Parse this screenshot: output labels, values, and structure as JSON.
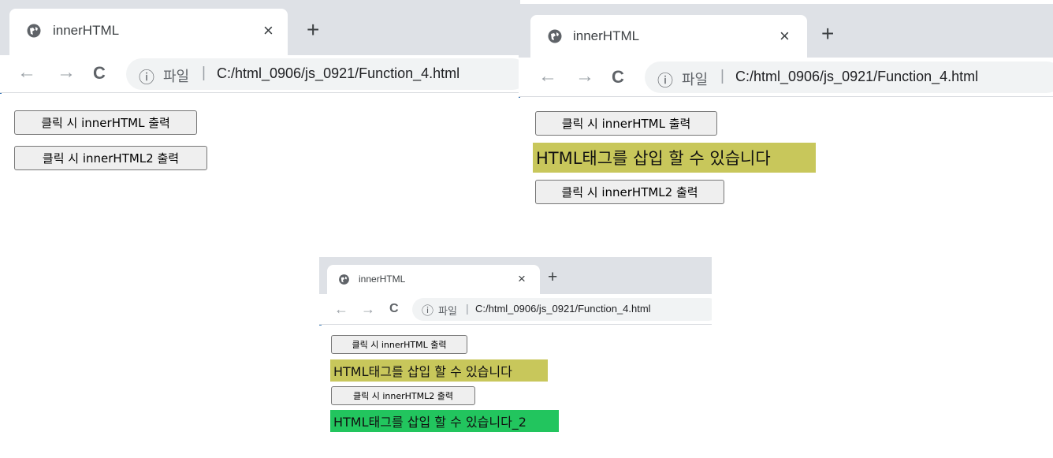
{
  "windows": [
    {
      "tab_title": "innerHTML",
      "tab_close": "×",
      "new_tab": "+",
      "nav": {
        "back": "←",
        "forward": "→",
        "reload": "C"
      },
      "address": {
        "info": "ⓘ",
        "scheme": "파일",
        "separator": "|",
        "url": "C:/html_0906/js_0921/Function_4.html"
      },
      "button1": "클릭 시 innerHTML 출력",
      "button2": "클릭 시 innerHTML2 출력"
    },
    {
      "tab_title": "innerHTML",
      "tab_close": "×",
      "new_tab": "+",
      "nav": {
        "back": "←",
        "forward": "→",
        "reload": "C"
      },
      "address": {
        "info": "ⓘ",
        "scheme": "파일",
        "separator": "|",
        "url": "C:/html_0906/js_0921/Function_4.html"
      },
      "button1": "클릭 시 innerHTML 출력",
      "output1": "HTML태그를 삽입 할 수 있습니다",
      "button2": "클릭 시 innerHTML2 출력"
    },
    {
      "tab_title": "innerHTML",
      "tab_close": "×",
      "new_tab": "+",
      "nav": {
        "back": "←",
        "forward": "→",
        "reload": "C"
      },
      "address": {
        "info": "ⓘ",
        "scheme": "파일",
        "separator": "|",
        "url": "C:/html_0906/js_0921/Function_4.html"
      },
      "button1": "클릭 시 innerHTML 출력",
      "output1": "HTML태그를 삽입 할 수 있습니다",
      "button2": "클릭 시 innerHTML2 출력",
      "output2": "HTML태그를 삽입 할 수 있습니다_2"
    }
  ],
  "colors": {
    "tabstrip": "#dee1e6",
    "omnibox": "#f1f3f4",
    "output_yellow": "#c8c75b",
    "output_green": "#22c55e",
    "window_edge": "#2b6cb0"
  },
  "icons": {
    "tab_favicon": "globe-icon",
    "info": "info-circle-icon"
  }
}
